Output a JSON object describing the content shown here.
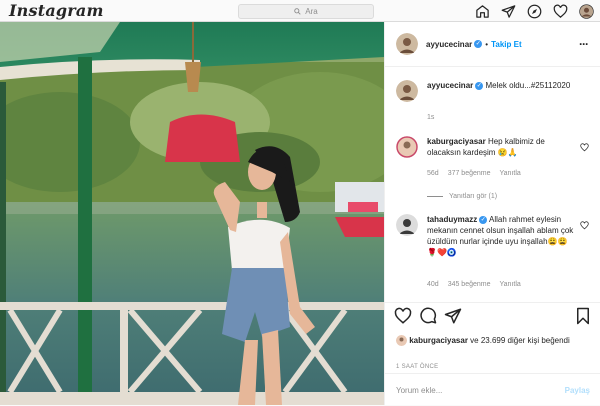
{
  "app": {
    "logo": "Instagram"
  },
  "search": {
    "placeholder": "Ara",
    "icon": "search-icon"
  },
  "nav": {
    "icons": [
      "home-icon",
      "direct-icon",
      "explore-icon",
      "activity-heart-icon",
      "profile-avatar"
    ]
  },
  "post": {
    "author": "ayyucecinar",
    "follow_label": "Takip Et",
    "caption_user": "ayyucecinar",
    "caption_text": "Melek oldu...#25112020",
    "caption_age": "1s"
  },
  "comments": [
    {
      "user": "kaburgaciyasar",
      "text": "Hep kalbimiz de olacaksın kardeşim 😢🙏",
      "age": "56d",
      "likes": "377 beğenme",
      "reply": "Yanıtla",
      "replies_label": "Yanıtları gör (1)"
    },
    {
      "user": "tahaduymazz",
      "text": "Allah rahmet eylesin mekanın cennet olsun inşallah ablam çok üzüldüm nurlar içinde uyu inşallah😩😩🌹❤️🧿",
      "age": "40d",
      "likes": "345 beğenme",
      "reply": "Yanıtla"
    }
  ],
  "likes": {
    "user": "kaburgaciyasar",
    "rest": " ve 23.699 diğer kişi beğendi"
  },
  "timestamp": "1 SAAT ÖNCE",
  "add_comment": {
    "placeholder": "Yorum ekle...",
    "post_label": "Paylaş"
  },
  "colors": {
    "accent": "#0095f6",
    "verified": "#3897f0",
    "text": "#262626",
    "muted": "#8e8e8e"
  }
}
